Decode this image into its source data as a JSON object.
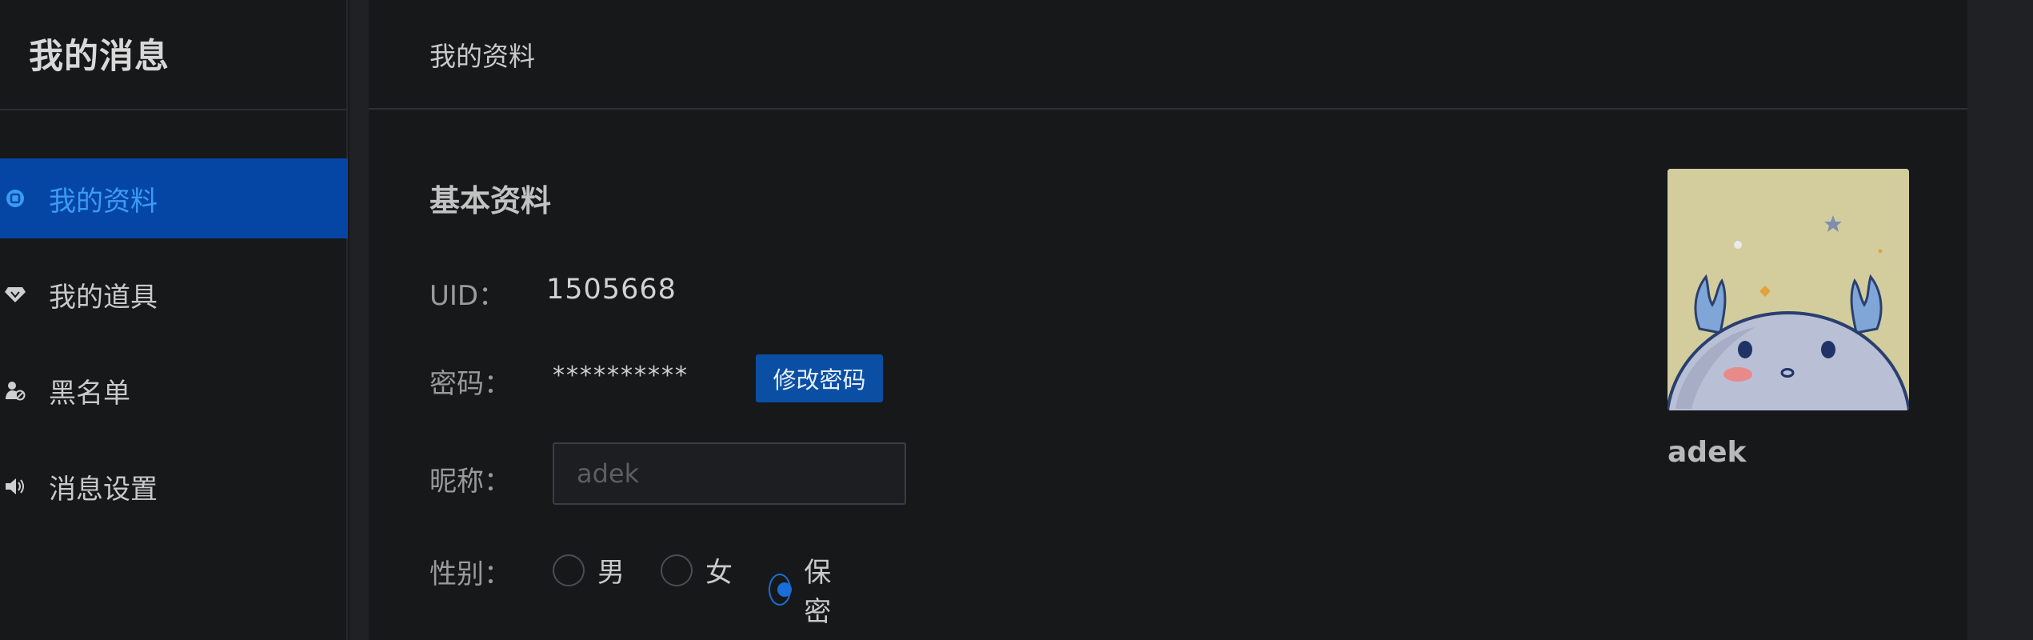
{
  "sidebar": {
    "title": "我的消息",
    "items": [
      {
        "label": "我的资料",
        "icon": "profile-icon",
        "active": true
      },
      {
        "label": "我的道具",
        "icon": "diamond-icon",
        "active": false
      },
      {
        "label": "黑名单",
        "icon": "block-user-icon",
        "active": false
      },
      {
        "label": "消息设置",
        "icon": "speaker-icon",
        "active": false
      }
    ]
  },
  "header": {
    "title": "我的资料"
  },
  "profile": {
    "section_title": "基本资料",
    "uid_label": "UID：",
    "uid_value": "1505668",
    "password_label": "密码：",
    "password_value": "**********",
    "change_password_label": "修改密码",
    "nickname_label": "昵称：",
    "nickname_placeholder": "adek",
    "gender_label": "性别：",
    "gender_options": [
      {
        "label": "男",
        "checked": false
      },
      {
        "label": "女",
        "checked": false
      },
      {
        "label": "保密",
        "checked": true
      }
    ],
    "username": "adek"
  },
  "colors": {
    "accent": "#0546a5",
    "active_text": "#3a9bf5",
    "background": "#17181a"
  }
}
